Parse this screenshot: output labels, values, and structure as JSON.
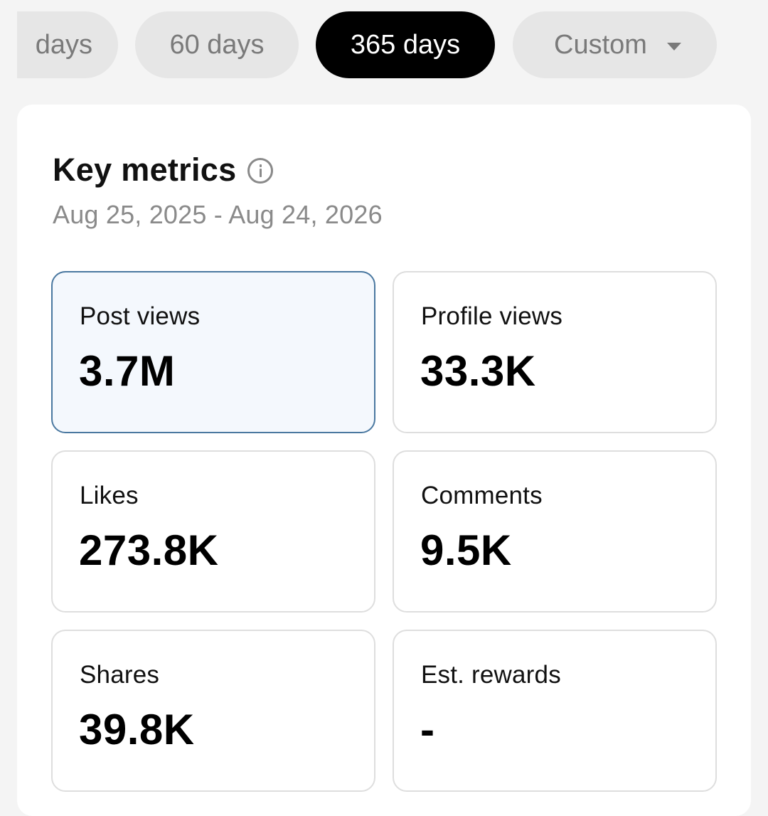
{
  "filters": {
    "chips": [
      {
        "label": "days",
        "selected": false
      },
      {
        "label": "60 days",
        "selected": false
      },
      {
        "label": "365 days",
        "selected": true
      },
      {
        "label": "Custom",
        "selected": false,
        "icon": "caret-down-icon"
      }
    ]
  },
  "key_metrics": {
    "title": "Key metrics",
    "info_icon": "info-icon",
    "date_range": "Aug 25, 2025 - Aug 24, 2026",
    "metrics": [
      {
        "label": "Post views",
        "value": "3.7M",
        "selected": true
      },
      {
        "label": "Profile views",
        "value": "33.3K",
        "selected": false
      },
      {
        "label": "Likes",
        "value": "273.8K",
        "selected": false
      },
      {
        "label": "Comments",
        "value": "9.5K",
        "selected": false
      },
      {
        "label": "Shares",
        "value": "39.8K",
        "selected": false
      },
      {
        "label": "Est. rewards",
        "value": "-",
        "selected": false
      }
    ]
  },
  "colors": {
    "page_background": "#f4f4f4",
    "chip_background": "#e6e6e6",
    "chip_selected_background": "#000000",
    "selected_card_background": "#f4f8fd",
    "selected_card_border": "#4a78a0",
    "muted_text": "#8a8a8a"
  }
}
